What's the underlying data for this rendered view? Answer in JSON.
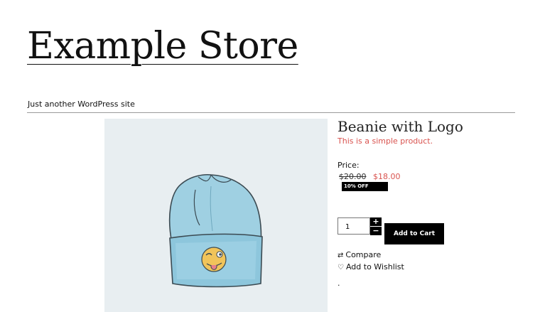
{
  "site": {
    "title": "Example Store",
    "tagline": "Just another WordPress site"
  },
  "product": {
    "title": "Beanie with Logo",
    "short_description": "This is a simple product.",
    "price_label": "Price:",
    "regular_price": "$20.00",
    "sale_price": "$18.00",
    "discount_badge": "10% OFF",
    "image_icon": "beanie-with-winking-emoji-logo"
  },
  "cart": {
    "quantity": "1",
    "plus_symbol": "+",
    "minus_symbol": "−",
    "add_to_cart_label": "Add to Cart"
  },
  "actions": {
    "compare_icon": "⇄",
    "compare_label": "Compare",
    "wishlist_icon": "♡",
    "wishlist_label": "Add to Wishlist"
  },
  "misc": {
    "trailing_dot": "."
  },
  "colors": {
    "sale": "#d9534f",
    "image_background": "#e8eef1",
    "beanie": "#9fd0e2",
    "button": "#000000"
  }
}
